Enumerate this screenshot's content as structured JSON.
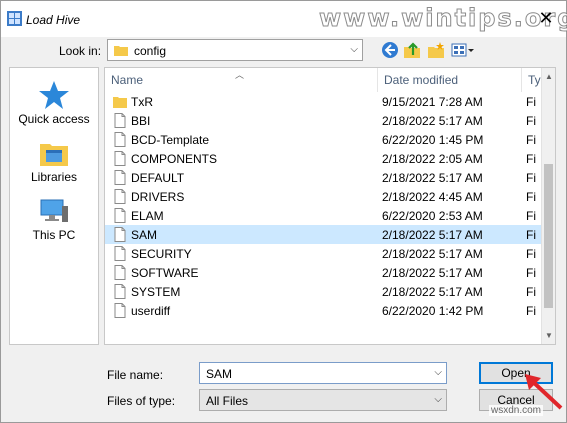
{
  "window": {
    "title": "Load Hive",
    "close_glyph": "✕"
  },
  "watermark": "www.wintips.org",
  "credit": "wsxdn.com",
  "look_in": {
    "label": "Look in:",
    "value": "config"
  },
  "places": [
    {
      "label": "Quick access",
      "icon": "star-icon"
    },
    {
      "label": "Libraries",
      "icon": "libraries-icon"
    },
    {
      "label": "This PC",
      "icon": "computer-icon"
    }
  ],
  "columns": {
    "name": "Name",
    "date": "Date modified",
    "type": "Ty"
  },
  "files": [
    {
      "name": "TxR",
      "date": "9/15/2021 7:28 AM",
      "type": "Fi",
      "kind": "folder"
    },
    {
      "name": "BBI",
      "date": "2/18/2022 5:17 AM",
      "type": "Fi",
      "kind": "file"
    },
    {
      "name": "BCD-Template",
      "date": "6/22/2020 1:45 PM",
      "type": "Fi",
      "kind": "file"
    },
    {
      "name": "COMPONENTS",
      "date": "2/18/2022 2:05 AM",
      "type": "Fi",
      "kind": "file"
    },
    {
      "name": "DEFAULT",
      "date": "2/18/2022 5:17 AM",
      "type": "Fi",
      "kind": "file"
    },
    {
      "name": "DRIVERS",
      "date": "2/18/2022 4:45 AM",
      "type": "Fi",
      "kind": "file"
    },
    {
      "name": "ELAM",
      "date": "6/22/2020 2:53 AM",
      "type": "Fi",
      "kind": "file"
    },
    {
      "name": "SAM",
      "date": "2/18/2022 5:17 AM",
      "type": "Fi",
      "kind": "file",
      "selected": true
    },
    {
      "name": "SECURITY",
      "date": "2/18/2022 5:17 AM",
      "type": "Fi",
      "kind": "file"
    },
    {
      "name": "SOFTWARE",
      "date": "2/18/2022 5:17 AM",
      "type": "Fi",
      "kind": "file"
    },
    {
      "name": "SYSTEM",
      "date": "2/18/2022 5:17 AM",
      "type": "Fi",
      "kind": "file"
    },
    {
      "name": "userdiff",
      "date": "6/22/2020 1:42 PM",
      "type": "Fi",
      "kind": "file"
    }
  ],
  "file_name": {
    "label": "File name:",
    "value": "SAM"
  },
  "file_type": {
    "label": "Files of type:",
    "value": "All Files"
  },
  "buttons": {
    "open": "Open",
    "cancel": "Cancel"
  },
  "colors": {
    "selection": "#cce8ff",
    "folder": "#f5c94a",
    "accent": "#0078d7",
    "arrow": "#e0262b"
  }
}
